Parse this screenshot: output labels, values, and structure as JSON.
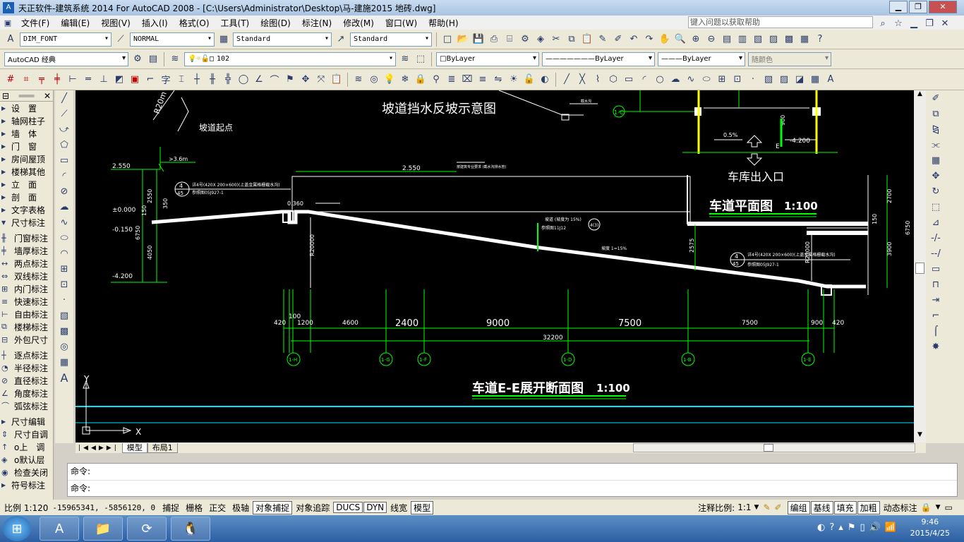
{
  "window": {
    "title": "天正软件-建筑系统 2014  For AutoCAD 2008 - [C:\\Users\\Administrator\\Desktop\\马-建施2015 地砖.dwg]",
    "app_icon": "tangent-app-icon"
  },
  "menu": [
    "文件(F)",
    "编辑(E)",
    "视图(V)",
    "插入(I)",
    "格式(O)",
    "工具(T)",
    "绘图(D)",
    "标注(N)",
    "修改(M)",
    "窗口(W)",
    "帮助(H)"
  ],
  "help_search": {
    "placeholder": "键入问题以获取帮助"
  },
  "toolbar1": {
    "dim_style": "DIM_FONT",
    "text_style": "NORMAL",
    "table_style": "Standard",
    "multileader_style": "Standard"
  },
  "toolbar2": {
    "workspace": "AutoCAD 经典",
    "layer": "102",
    "color": "ByLayer",
    "linetype": "ByLayer",
    "lineweight": "ByLayer",
    "plotstyle": "随颜色"
  },
  "left_panel": [
    {
      "label": "设　置",
      "arrow": true
    },
    {
      "label": "轴网柱子",
      "arrow": true
    },
    {
      "label": "墙　体",
      "arrow": true
    },
    {
      "label": "门　窗",
      "arrow": true
    },
    {
      "label": "房间屋顶",
      "arrow": true
    },
    {
      "label": "楼梯其他",
      "arrow": true
    },
    {
      "label": "立　面",
      "arrow": true
    },
    {
      "label": "剖　面",
      "arrow": true
    },
    {
      "label": "文字表格",
      "arrow": true
    },
    {
      "label": "尺寸标注",
      "arrow": true,
      "expanded": true
    },
    {
      "label": "门窗标注",
      "icon": "╫"
    },
    {
      "label": "墙厚标注",
      "icon": "╪"
    },
    {
      "label": "两点标注",
      "icon": "↔"
    },
    {
      "label": "双线标注",
      "icon": "⇔"
    },
    {
      "label": "内门标注",
      "icon": "⊞"
    },
    {
      "label": "快速标注",
      "icon": "≡"
    },
    {
      "label": "自由标注",
      "icon": "⊢"
    },
    {
      "label": "楼梯标注",
      "icon": "⧉"
    },
    {
      "label": "外包尺寸",
      "icon": "⊟"
    },
    {
      "label": "逐点标注",
      "icon": "┼"
    },
    {
      "label": "半径标注",
      "icon": "◔"
    },
    {
      "label": "直径标注",
      "icon": "⊘"
    },
    {
      "label": "角度标注",
      "icon": "∠"
    },
    {
      "label": "弧弦标注",
      "icon": "⌒"
    },
    {
      "label": "尺寸编辑",
      "arrow": true
    },
    {
      "label": "尺寸自调",
      "icon": "⇕"
    },
    {
      "label": "o上　调",
      "icon": "↑"
    },
    {
      "label": "o默认层",
      "icon": "◈"
    },
    {
      "label": "检查关闭",
      "icon": "◉"
    },
    {
      "label": "符号标注",
      "arrow": true
    }
  ],
  "drawing": {
    "title_top": "坡道挡水反坡示意图",
    "label_r20m": "R20m",
    "label_slope_start": "坡道起点",
    "label_drain_top": "截水沟",
    "label_garage_entrance": "车库出入口",
    "plan_title": "车道平面图",
    "plan_scale": "1:100",
    "section_title": "车道E-E展开断面图",
    "section_scale": "1:100",
    "levels": {
      "l1": "2.550",
      "l2": "±0.000",
      "l3": "-0.150",
      "l4": "-4.200",
      "l5": "2.550"
    },
    "left_dims": {
      "d1": "2550",
      "d2": "6750",
      "d3": "4050",
      "d4": "350",
      "d5": "150"
    },
    "note_a": "详4号(420X 200×600)(上盖金属格栅截水沟)",
    "note_b": "参照图05J927-1",
    "note_slope": "坡道 (坡度为 15%)",
    "note_slope2": "参照图11J12",
    "note_slope3": "坡度 1=15%",
    "note_c": "详4号(420X 200×600)(上盖金属格栅截水沟)",
    "note_d": "参照图05J927-1",
    "note_top": "按建筑专业要求 (截水沟排水管)",
    "label_360": "0.360",
    "label_r20000a": "R20000",
    "label_r20000b": "R20000",
    "label_2575": "2575",
    "label_3_6m": ">3.6m",
    "bubble_4": "4",
    "bubble_45": "45",
    "bubble_43": "4(3)",
    "plan_dims": {
      "d900": "900",
      "d05": "0.5%",
      "d4200": "-4.200",
      "dE": "E",
      "d2700": "2700",
      "d6750": "6750",
      "d3900": "3900",
      "d150": "150"
    },
    "bottom_dims": [
      "420",
      "100",
      "1200",
      "4600",
      "2400",
      "9000",
      "7500",
      "7500",
      "900",
      "420"
    ],
    "total_dim": "32200",
    "axis_labels": [
      "1-H",
      "1-G",
      "1-F",
      "1-D",
      "1-B",
      "1-E"
    ],
    "plan_axis_top": "1-C",
    "ucs_x": "X",
    "ucs_y": "Y"
  },
  "tabs": [
    "模型",
    "布局1"
  ],
  "command": {
    "line1": "命令:",
    "line2": "命令:"
  },
  "status": {
    "scale": "比例 1:120",
    "coords": "-15965341, -5856120, 0",
    "buttons": [
      "捕捉",
      "栅格",
      "正交",
      "极轴",
      "对象捕捉",
      "对象追踪",
      "DUCS",
      "DYN",
      "线宽",
      "模型"
    ],
    "on_buttons": [
      "对象捕捉",
      "DUCS",
      "DYN",
      "模型"
    ],
    "annotation_scale": "注释比例:",
    "annotation_value": "1:1",
    "right_buttons": [
      "编组",
      "基线",
      "填充",
      "加粗",
      "动态标注"
    ]
  },
  "taskbar": {
    "time": "9:46",
    "date": "2015/4/25"
  },
  "colors": {
    "canvas": "#000000",
    "line_white": "#ffffff",
    "line_green": "#00ff00",
    "cyan": "#00e5ff",
    "yellow": "#ffff00"
  }
}
